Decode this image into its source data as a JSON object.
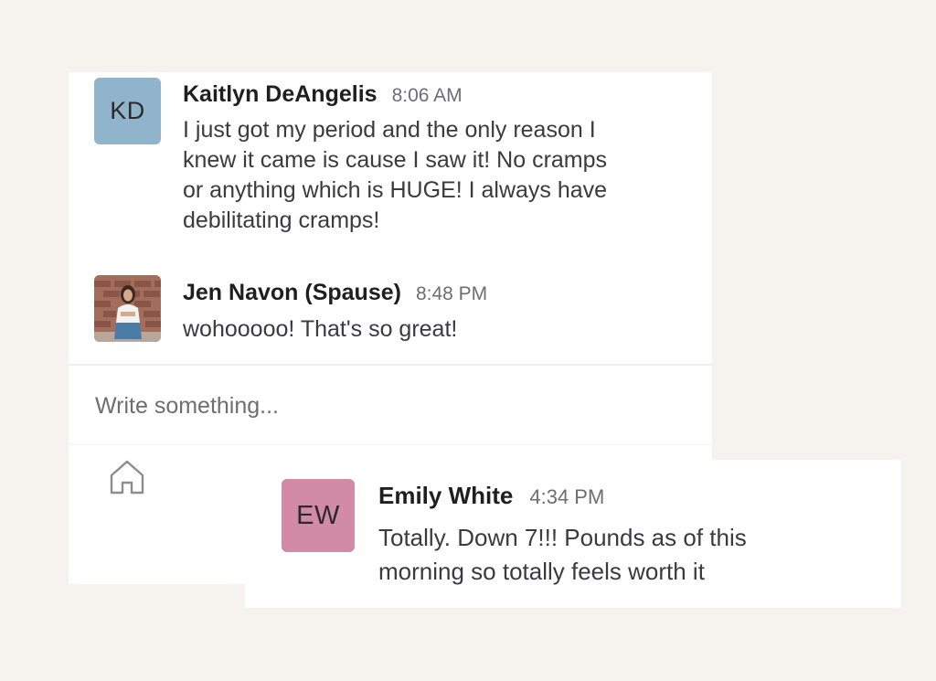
{
  "messages": [
    {
      "initials": "KD",
      "name": "Kaitlyn DeAngelis",
      "time": "8:06 AM",
      "text_lines": [
        "I just got my period and the only reason I",
        "knew it came is cause I saw it! No cramps",
        "or anything which is HUGE! I always have",
        "debilitating cramps!"
      ],
      "avatar_color": "#8fb4cb"
    },
    {
      "name": "Jen Navon (Spause)",
      "time": "8:48 PM",
      "text": "wohooooo! That's so great!",
      "avatar": "photo"
    },
    {
      "initials": "EW",
      "name": "Emily White",
      "time": "4:34 PM",
      "text_lines": [
        "Totally. Down 7!!! Pounds as of this",
        "morning so totally feels worth it"
      ],
      "avatar_color": "#d28ba4"
    }
  ],
  "composer": {
    "placeholder": "Write something..."
  },
  "nav": {
    "icon": "home-icon"
  },
  "colors": {
    "background": "#f6f3ee",
    "card": "#ffffff"
  }
}
